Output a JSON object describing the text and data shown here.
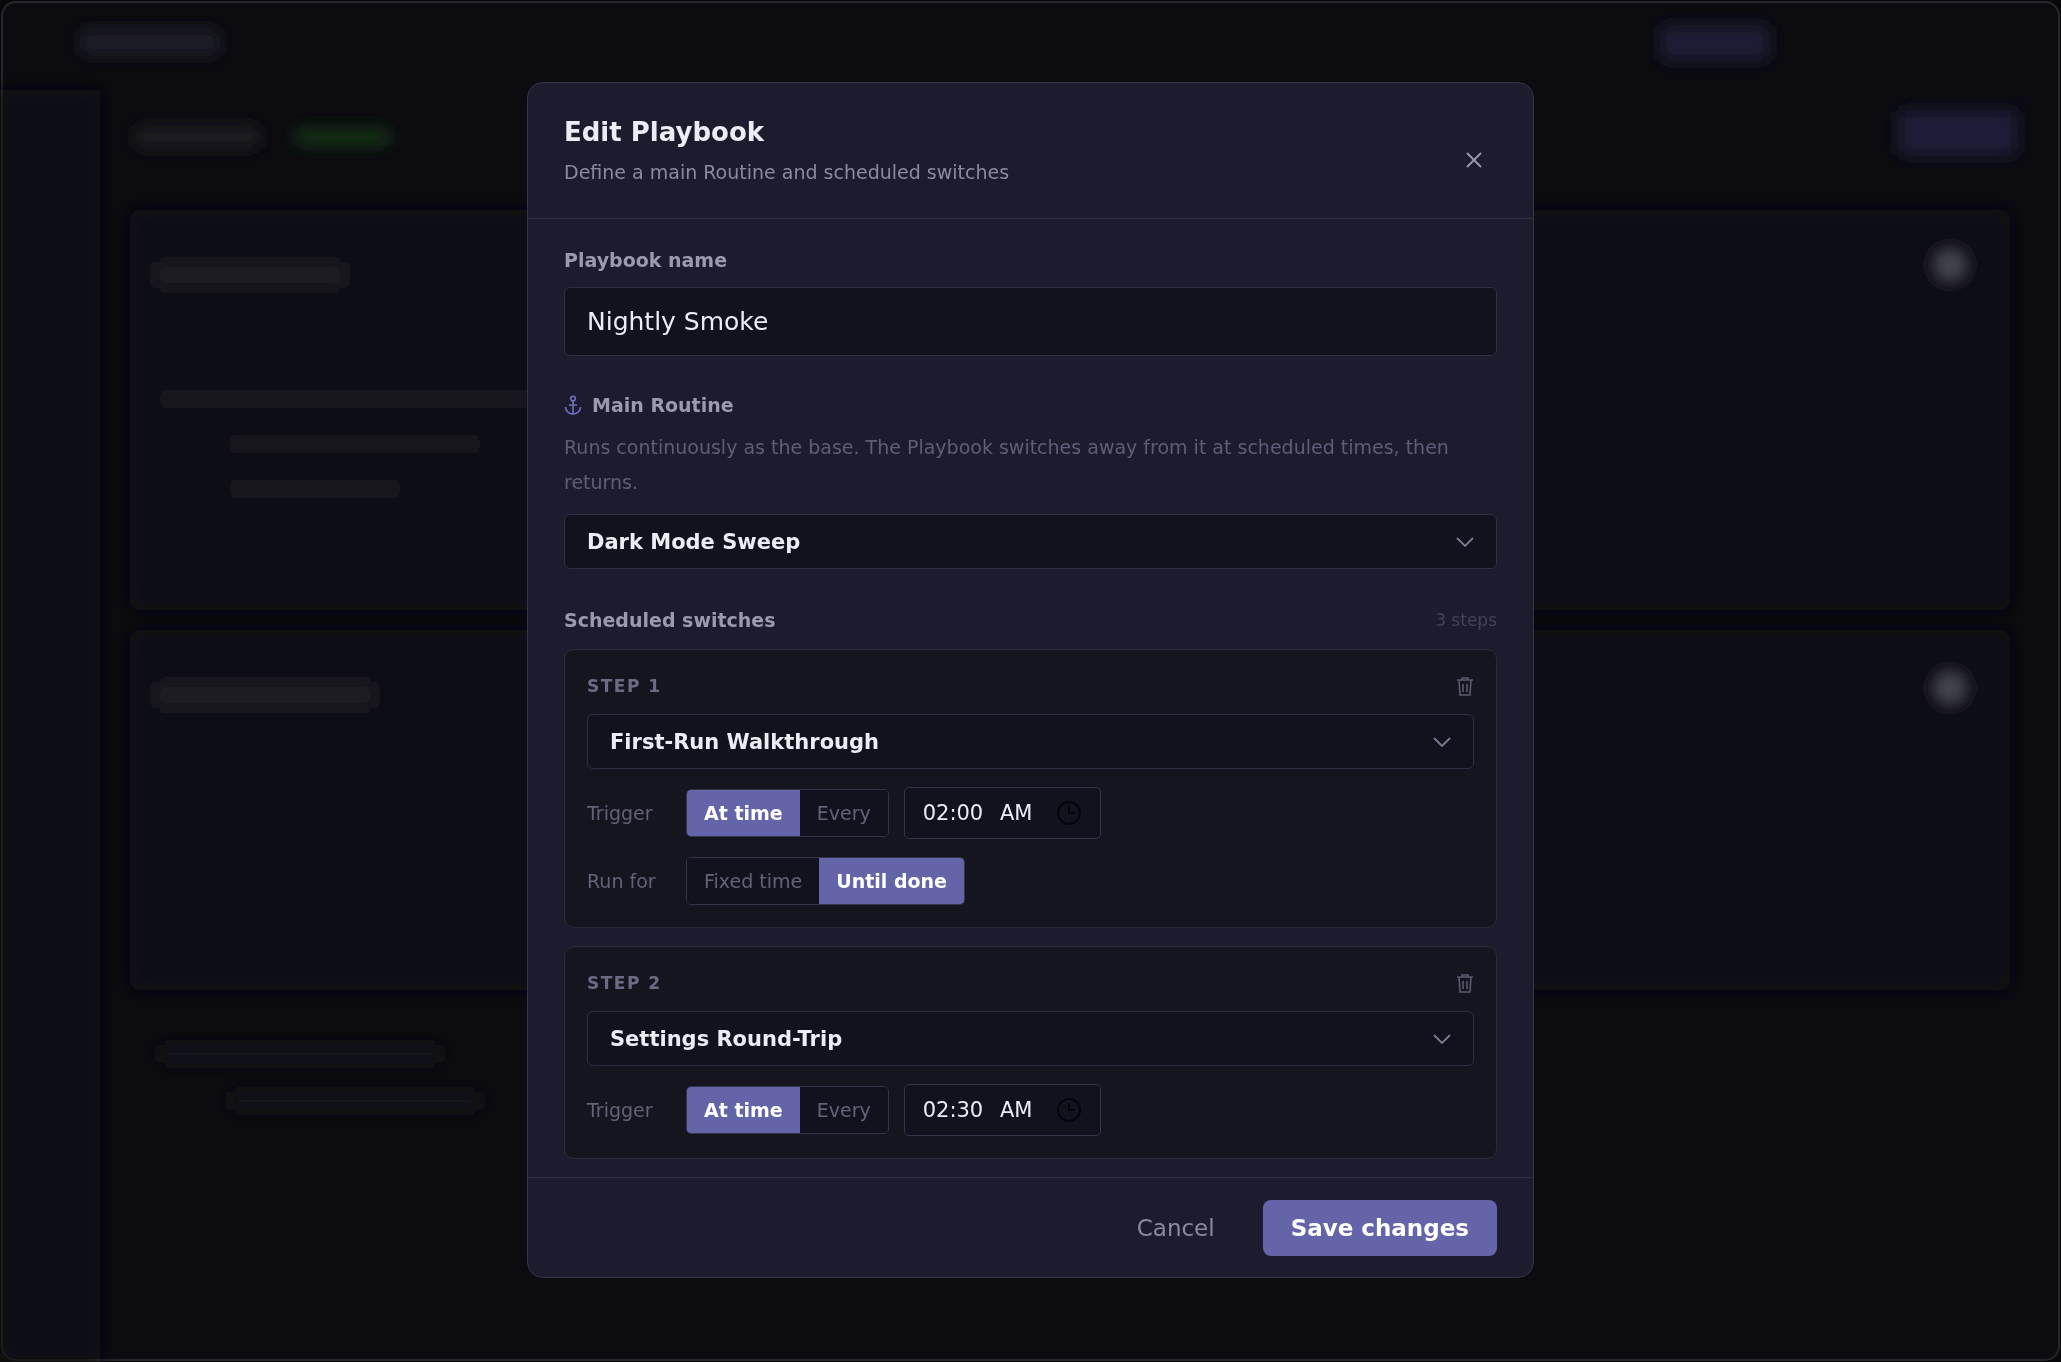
{
  "dialog": {
    "title": "Edit Playbook",
    "subtitle": "Define a main Routine and scheduled switches",
    "name_label": "Playbook name",
    "name_value": "Nightly Smoke",
    "main_label": "Main Routine",
    "main_description": "Runs continuously as the base. The Playbook switches away from it at scheduled times, then returns.",
    "main_routine": "Dark Mode Sweep",
    "switches_label": "Scheduled switches",
    "switches_count": "3 steps",
    "steps": [
      {
        "label": "STEP 1",
        "routine": "First-Run Walkthrough",
        "trigger_label": "Trigger",
        "trigger_options": [
          {
            "label": "At time",
            "selected": true
          },
          {
            "label": "Every",
            "selected": false
          }
        ],
        "time": "02:00",
        "period": "AM",
        "run_label": "Run for",
        "run_options": [
          {
            "label": "Fixed time",
            "selected": false
          },
          {
            "label": "Until done",
            "selected": true
          }
        ]
      },
      {
        "label": "STEP 2",
        "routine": "Settings Round-Trip",
        "trigger_label": "Trigger",
        "trigger_options": [
          {
            "label": "At time",
            "selected": true
          },
          {
            "label": "Every",
            "selected": false
          }
        ],
        "time": "02:30",
        "period": "AM"
      }
    ],
    "cancel": "Cancel",
    "save": "Save changes"
  }
}
